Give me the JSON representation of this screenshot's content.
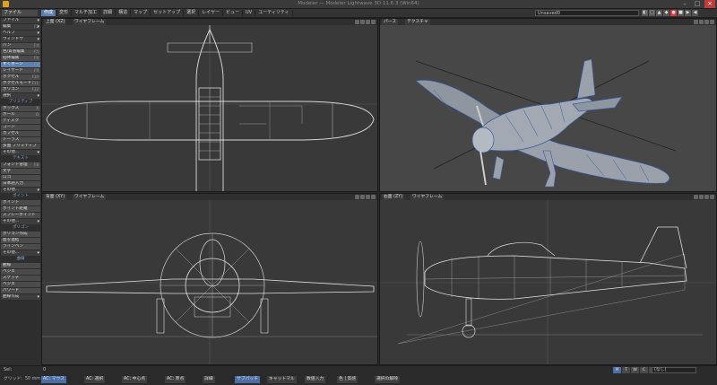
{
  "window": {
    "title": "Modeler — Modeler Lightwave 3D 11.6.3 (Win64)",
    "minimize": "–",
    "maximize": "□",
    "close": "×"
  },
  "toolbar": {
    "file_menu": "ファイル",
    "tabs": [
      {
        "label": "作成",
        "active": true
      },
      {
        "label": "変形",
        "active": false
      },
      {
        "label": "マルチ加工",
        "active": false
      },
      {
        "label": "詳細",
        "active": false
      },
      {
        "label": "構造",
        "active": false
      },
      {
        "label": "マップ",
        "active": false
      },
      {
        "label": "セットアップ",
        "active": false
      },
      {
        "label": "選択",
        "active": false
      },
      {
        "label": "レイヤー",
        "active": false
      },
      {
        "label": "ビュー",
        "active": false
      },
      {
        "label": "UV",
        "active": false
      },
      {
        "label": "ユーティリティ",
        "active": false
      }
    ],
    "scene_select": "Unsaved0",
    "right_icons": [
      "◧",
      "□",
      "▲",
      "◆",
      "●",
      "■",
      "▶",
      "◀"
    ]
  },
  "sidebar": {
    "top_items": [
      {
        "label": "ファイル",
        "dd": true
      },
      {
        "label": "編集",
        "shortcut": "F2",
        "dd": true
      },
      {
        "label": "ヘルプ",
        "dd": true
      },
      {
        "label": "ウィンドウ",
        "dd": true
      },
      {
        "label": "パン",
        "shortcut": "F4"
      },
      {
        "label": "色/質感編集",
        "shortcut": "F5"
      },
      {
        "label": "個体編集",
        "shortcut": "F6"
      },
      {
        "label": "すくボーン",
        "shortcut": "F8",
        "sel": true
      },
      {
        "label": "レイヤード",
        "shortcut": "F9"
      },
      {
        "label": "ボクセル",
        "shortcut": "F10"
      },
      {
        "label": "ボクセルモード",
        "shortcut": "F11"
      },
      {
        "label": "ポリゴン",
        "shortcut": "F12"
      },
      {
        "label": "選択",
        "dd": true
      }
    ],
    "primitive_head": "プリミティブ",
    "primitive_items": [
      {
        "label": "ボックス",
        "shortcut": "X"
      },
      {
        "label": "ボール",
        "shortcut": "O"
      },
      {
        "label": "ディスク"
      },
      {
        "label": "コーン"
      },
      {
        "label": "カプセル"
      },
      {
        "label": "トーラス"
      },
      {
        "label": "多面 プリミティブ"
      },
      {
        "label": "その他...",
        "dd": true
      }
    ],
    "text_head": "テキスト",
    "text_items": [
      {
        "label": "フォント管理",
        "shortcut": "F8"
      },
      {
        "label": "文字"
      },
      {
        "label": "ロゴ"
      },
      {
        "label": "日本語入力"
      },
      {
        "label": "その他...",
        "dd": true
      }
    ],
    "points_head": "ポイント",
    "points_items": [
      {
        "label": "ポイント"
      },
      {
        "label": "ポイント距離"
      },
      {
        "label": "スプレーポイント"
      },
      {
        "label": "その他...",
        "dd": true
      }
    ],
    "poly_head": "ポリゴン",
    "poly_items": [
      {
        "label": "ポリゴン作成"
      },
      {
        "label": "面を連結"
      },
      {
        "label": "ラインベン"
      },
      {
        "label": "その他...",
        "dd": true
      }
    ],
    "curve_head": "曲線",
    "curve_items": [
      {
        "label": "曲線"
      },
      {
        "label": "ベジエ"
      },
      {
        "label": "スケッチ"
      },
      {
        "label": "ベジエ"
      },
      {
        "label": "パワード"
      },
      {
        "label": "曲線作成",
        "dd": true
      }
    ]
  },
  "viewports": [
    {
      "name": "top",
      "view": "上面 (XZ)",
      "mode": "ワイヤフレーム"
    },
    {
      "name": "perspective",
      "view": "パース",
      "mode": "テクスチャ"
    },
    {
      "name": "front",
      "view": "背面 (XY)",
      "mode": "ワイヤフレーム"
    },
    {
      "name": "side",
      "view": "右面 (ZY)",
      "mode": "ワイヤフレーム"
    }
  ],
  "status": {
    "sel_label": "Sel:",
    "sel_value": "0",
    "grid_label": "グリッド:",
    "grid_value": "50 mm",
    "keypad": [
      "M",
      "T",
      "W",
      "C",
      "S"
    ],
    "layer": "(なし)",
    "items": [
      {
        "label": "AC: マウス",
        "blue": true
      },
      {
        "label": "AC: 選択",
        "blue": false
      },
      {
        "label": "AC: 中心点",
        "blue": false
      },
      {
        "label": "AC: 原点",
        "blue": false
      },
      {
        "label": "詳細",
        "blue": false
      },
      {
        "label": "サブパッチ",
        "blue": true
      },
      {
        "label": "キャットマル",
        "blue": false
      },
      {
        "label": "数値入力",
        "blue": false
      },
      {
        "label": "色 | 質感",
        "blue": false
      },
      {
        "label": "選択の解除",
        "blue": false
      }
    ]
  }
}
